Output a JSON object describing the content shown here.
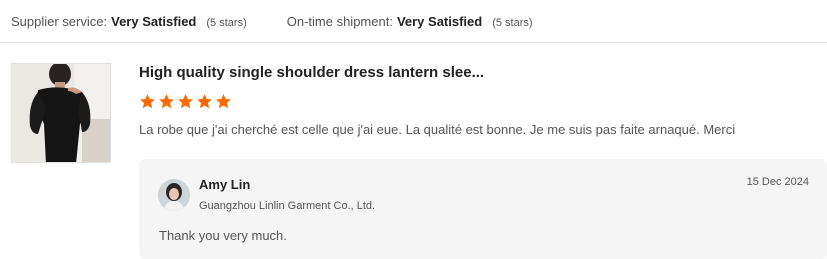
{
  "ratings": {
    "supplier_service": {
      "label": "Supplier service:",
      "value": "Very Satisfied",
      "stars": "(5 stars)"
    },
    "shipment": {
      "label": "On-time shipment:",
      "value": "Very Satisfied",
      "stars": "(5 stars)"
    }
  },
  "review": {
    "product_title": "High quality single shoulder dress lantern slee...",
    "rating": 5,
    "rating_max": 5,
    "star_color": "#ff6a00",
    "text": "La robe que j'ai cherché est celle que j'ai eue. La qualité est bonne. Je me suis pas faite arnaqué. Merci",
    "reply": {
      "name": "Amy Lin",
      "company": "Guangzhou Linlin Garment Co., Ltd.",
      "date": "15 Dec 2024",
      "text": "Thank you very much."
    }
  }
}
